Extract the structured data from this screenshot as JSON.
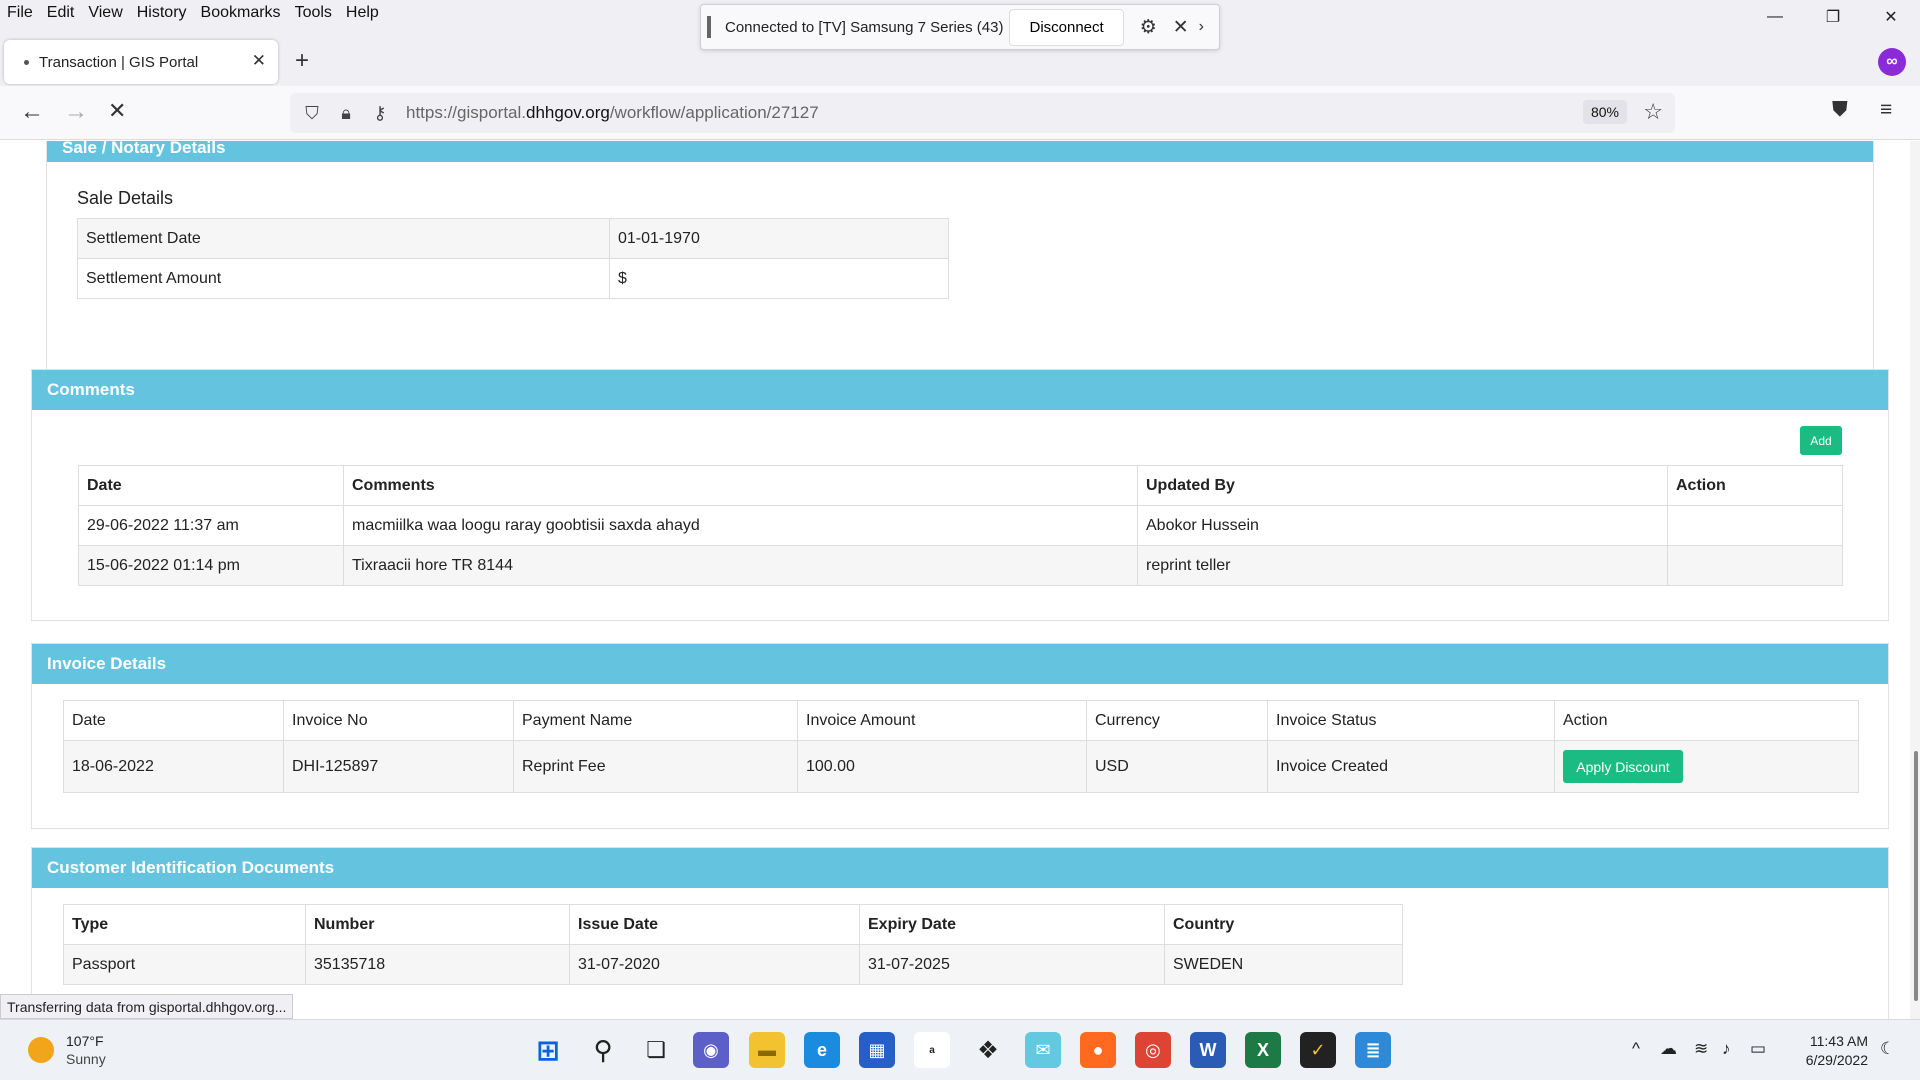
{
  "menu": [
    "File",
    "Edit",
    "View",
    "History",
    "Bookmarks",
    "Tools",
    "Help"
  ],
  "cast": {
    "status": "Connected to [TV] Samsung 7 Series (43)",
    "disconnect_label": "Disconnect"
  },
  "tab": {
    "title": "Transaction | GIS Portal"
  },
  "url": {
    "prefix": "https://gisportal.",
    "domain": "dhhgov.org",
    "path": "/workflow/application/27127",
    "zoom": "80%"
  },
  "sale": {
    "header": "Sale / Notary Details",
    "subtitle": "Sale Details",
    "rows": [
      {
        "label": "Settlement Date",
        "value": "01-01-1970"
      },
      {
        "label": "Settlement Amount",
        "value": "$"
      }
    ]
  },
  "comments": {
    "header": "Comments",
    "add_label": "Add",
    "columns": [
      "Date",
      "Comments",
      "Updated By",
      "Action"
    ],
    "rows": [
      {
        "date": "29-06-2022 11:37 am",
        "comment": "macmiilka waa loogu raray goobtisii saxda ahayd",
        "updated_by": "Abokor Hussein",
        "action": ""
      },
      {
        "date": "15-06-2022 01:14 pm",
        "comment": "Tixraacii hore TR 8144",
        "updated_by": "reprint teller",
        "action": ""
      }
    ]
  },
  "invoice": {
    "header": "Invoice Details",
    "columns": [
      "Date",
      "Invoice No",
      "Payment Name",
      "Invoice Amount",
      "Currency",
      "Invoice Status",
      "Action"
    ],
    "rows": [
      {
        "date": "18-06-2022",
        "invoice_no": "DHI-125897",
        "payment_name": "Reprint Fee",
        "amount": "100.00",
        "currency": "USD",
        "status": "Invoice Created",
        "action_label": "Apply Discount"
      }
    ]
  },
  "docs": {
    "header": "Customer Identification Documents",
    "columns": [
      "Type",
      "Number",
      "Issue Date",
      "Expiry Date",
      "Country"
    ],
    "rows": [
      {
        "type": "Passport",
        "number": "35135718",
        "issue": "31-07-2020",
        "expiry": "31-07-2025",
        "country": "SWEDEN"
      }
    ]
  },
  "status_text": "Transferring data from gisportal.dhhgov.org...",
  "weather": {
    "temp": "107°F",
    "desc": "Sunny"
  },
  "clock": {
    "time": "11:43 AM",
    "date": "6/29/2022"
  },
  "colors": {
    "panel_header": "#64c4df",
    "green_button": "#1abc84"
  }
}
